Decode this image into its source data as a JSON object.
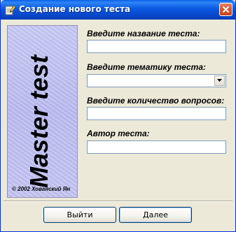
{
  "window": {
    "title": "Создание нового теста",
    "title_icon": "pencil-notepad-icon",
    "close_icon": "close-x-icon"
  },
  "banner": {
    "title": "Master test",
    "copyright": "© 2002 Хованский Ян"
  },
  "form": {
    "name": {
      "label": "Введите название теста:",
      "value": ""
    },
    "topic": {
      "label": "Введите тематику теста:",
      "value": "",
      "arrow_icon": "chevron-down-icon"
    },
    "count": {
      "label": "Введите количество вопросов:",
      "value": ""
    },
    "author": {
      "label": "Автор теста:",
      "value": ""
    }
  },
  "buttons": {
    "exit": "Выйти",
    "next": "Далее"
  },
  "colors": {
    "titlebar": "#0a58e0",
    "dialog_bg": "#ece9d8",
    "banner_bg": "#c2c3f0",
    "close_button": "#d9552f",
    "input_border": "#7f9db9"
  }
}
